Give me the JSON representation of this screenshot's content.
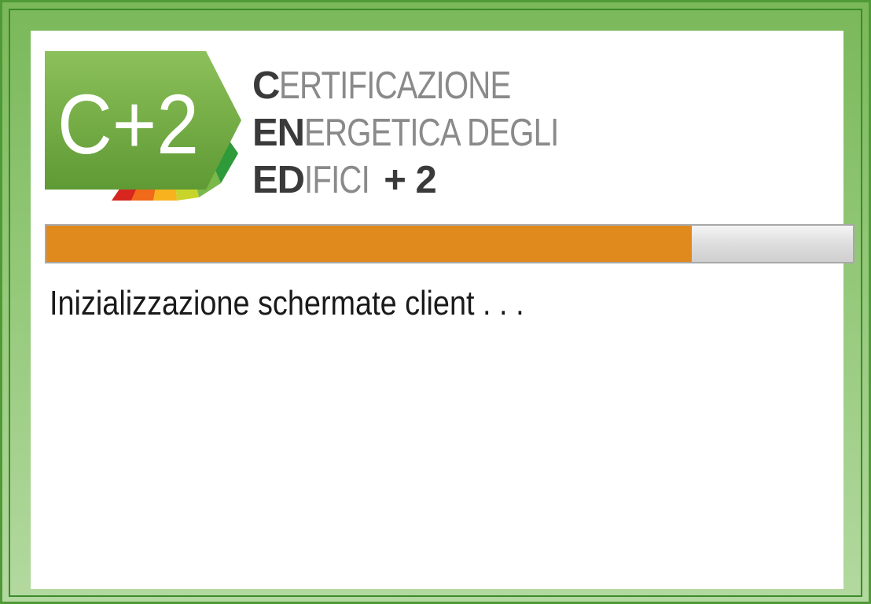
{
  "logo": {
    "badge_text": "C+2",
    "lines": [
      {
        "highlight": "C",
        "rest": "ERTIFICAZIONE",
        "plus": ""
      },
      {
        "highlight": "EN",
        "rest": "ERGETICA DEGLI",
        "plus": ""
      },
      {
        "highlight": "ED",
        "rest": "IFICI ",
        "plus": "+ 2"
      }
    ],
    "colors": {
      "badge_green": "#7bb04a",
      "badge_green_dark": "#4f8f2a",
      "scale": [
        "#d7261e",
        "#f06a1a",
        "#f7b21e",
        "#c9d42b",
        "#7bb84a",
        "#2e9a3a"
      ]
    }
  },
  "progress": {
    "value_percent": 80,
    "fill_color": "#e08a1e"
  },
  "status": {
    "text": "Inizializzazione schermate client . . ."
  }
}
